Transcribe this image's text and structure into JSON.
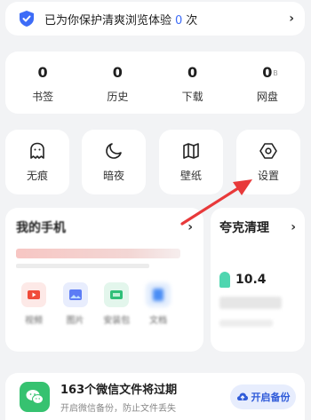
{
  "banner": {
    "text_before": "已为你保护清爽浏览体验",
    "count": "0",
    "text_after": "次",
    "icon": "shield-icon"
  },
  "stats": [
    {
      "value": "0",
      "label": "书签"
    },
    {
      "value": "0",
      "label": "历史"
    },
    {
      "value": "0",
      "label": "下载"
    },
    {
      "value": "0",
      "label": "网盘"
    }
  ],
  "tools": [
    {
      "label": "无痕",
      "icon": "ghost-icon"
    },
    {
      "label": "暗夜",
      "icon": "moon-icon"
    },
    {
      "label": "壁纸",
      "icon": "map-icon"
    },
    {
      "label": "设置",
      "icon": "settings-icon"
    }
  ],
  "phone": {
    "title": "我的手机",
    "apps": [
      {
        "label": "视频",
        "color": "#f04b3a"
      },
      {
        "label": "图片",
        "color": "#5c7cf5"
      },
      {
        "label": "安装包",
        "color": "#2fbf78"
      },
      {
        "label": "文档",
        "color": "#4a8df5"
      }
    ]
  },
  "clean": {
    "title": "夸克清理",
    "value": "10.4"
  },
  "backup": {
    "title": "163个微信文件将过期",
    "subtitle": "开启微信备份，防止文件丢失",
    "button": "开启备份"
  },
  "colors": {
    "accent": "#3d6cf7",
    "annotation_arrow": "#e8393a",
    "wechat_green": "#36c270"
  }
}
